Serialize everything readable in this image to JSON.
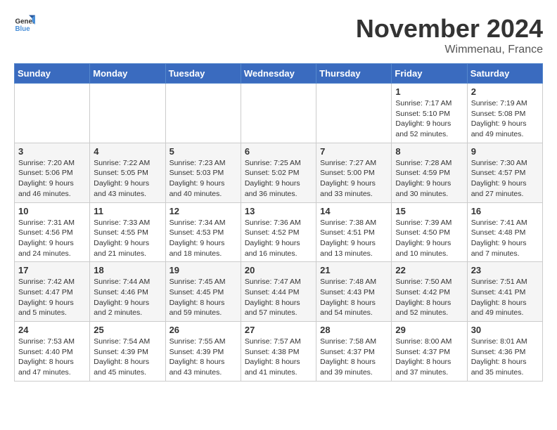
{
  "header": {
    "logo_general": "General",
    "logo_blue": "Blue",
    "month_title": "November 2024",
    "location": "Wimmenau, France"
  },
  "days_of_week": [
    "Sunday",
    "Monday",
    "Tuesday",
    "Wednesday",
    "Thursday",
    "Friday",
    "Saturday"
  ],
  "weeks": [
    [
      {
        "day": "",
        "info": ""
      },
      {
        "day": "",
        "info": ""
      },
      {
        "day": "",
        "info": ""
      },
      {
        "day": "",
        "info": ""
      },
      {
        "day": "",
        "info": ""
      },
      {
        "day": "1",
        "info": "Sunrise: 7:17 AM\nSunset: 5:10 PM\nDaylight: 9 hours and 52 minutes."
      },
      {
        "day": "2",
        "info": "Sunrise: 7:19 AM\nSunset: 5:08 PM\nDaylight: 9 hours and 49 minutes."
      }
    ],
    [
      {
        "day": "3",
        "info": "Sunrise: 7:20 AM\nSunset: 5:06 PM\nDaylight: 9 hours and 46 minutes."
      },
      {
        "day": "4",
        "info": "Sunrise: 7:22 AM\nSunset: 5:05 PM\nDaylight: 9 hours and 43 minutes."
      },
      {
        "day": "5",
        "info": "Sunrise: 7:23 AM\nSunset: 5:03 PM\nDaylight: 9 hours and 40 minutes."
      },
      {
        "day": "6",
        "info": "Sunrise: 7:25 AM\nSunset: 5:02 PM\nDaylight: 9 hours and 36 minutes."
      },
      {
        "day": "7",
        "info": "Sunrise: 7:27 AM\nSunset: 5:00 PM\nDaylight: 9 hours and 33 minutes."
      },
      {
        "day": "8",
        "info": "Sunrise: 7:28 AM\nSunset: 4:59 PM\nDaylight: 9 hours and 30 minutes."
      },
      {
        "day": "9",
        "info": "Sunrise: 7:30 AM\nSunset: 4:57 PM\nDaylight: 9 hours and 27 minutes."
      }
    ],
    [
      {
        "day": "10",
        "info": "Sunrise: 7:31 AM\nSunset: 4:56 PM\nDaylight: 9 hours and 24 minutes."
      },
      {
        "day": "11",
        "info": "Sunrise: 7:33 AM\nSunset: 4:55 PM\nDaylight: 9 hours and 21 minutes."
      },
      {
        "day": "12",
        "info": "Sunrise: 7:34 AM\nSunset: 4:53 PM\nDaylight: 9 hours and 18 minutes."
      },
      {
        "day": "13",
        "info": "Sunrise: 7:36 AM\nSunset: 4:52 PM\nDaylight: 9 hours and 16 minutes."
      },
      {
        "day": "14",
        "info": "Sunrise: 7:38 AM\nSunset: 4:51 PM\nDaylight: 9 hours and 13 minutes."
      },
      {
        "day": "15",
        "info": "Sunrise: 7:39 AM\nSunset: 4:50 PM\nDaylight: 9 hours and 10 minutes."
      },
      {
        "day": "16",
        "info": "Sunrise: 7:41 AM\nSunset: 4:48 PM\nDaylight: 9 hours and 7 minutes."
      }
    ],
    [
      {
        "day": "17",
        "info": "Sunrise: 7:42 AM\nSunset: 4:47 PM\nDaylight: 9 hours and 5 minutes."
      },
      {
        "day": "18",
        "info": "Sunrise: 7:44 AM\nSunset: 4:46 PM\nDaylight: 9 hours and 2 minutes."
      },
      {
        "day": "19",
        "info": "Sunrise: 7:45 AM\nSunset: 4:45 PM\nDaylight: 8 hours and 59 minutes."
      },
      {
        "day": "20",
        "info": "Sunrise: 7:47 AM\nSunset: 4:44 PM\nDaylight: 8 hours and 57 minutes."
      },
      {
        "day": "21",
        "info": "Sunrise: 7:48 AM\nSunset: 4:43 PM\nDaylight: 8 hours and 54 minutes."
      },
      {
        "day": "22",
        "info": "Sunrise: 7:50 AM\nSunset: 4:42 PM\nDaylight: 8 hours and 52 minutes."
      },
      {
        "day": "23",
        "info": "Sunrise: 7:51 AM\nSunset: 4:41 PM\nDaylight: 8 hours and 49 minutes."
      }
    ],
    [
      {
        "day": "24",
        "info": "Sunrise: 7:53 AM\nSunset: 4:40 PM\nDaylight: 8 hours and 47 minutes."
      },
      {
        "day": "25",
        "info": "Sunrise: 7:54 AM\nSunset: 4:39 PM\nDaylight: 8 hours and 45 minutes."
      },
      {
        "day": "26",
        "info": "Sunrise: 7:55 AM\nSunset: 4:39 PM\nDaylight: 8 hours and 43 minutes."
      },
      {
        "day": "27",
        "info": "Sunrise: 7:57 AM\nSunset: 4:38 PM\nDaylight: 8 hours and 41 minutes."
      },
      {
        "day": "28",
        "info": "Sunrise: 7:58 AM\nSunset: 4:37 PM\nDaylight: 8 hours and 39 minutes."
      },
      {
        "day": "29",
        "info": "Sunrise: 8:00 AM\nSunset: 4:37 PM\nDaylight: 8 hours and 37 minutes."
      },
      {
        "day": "30",
        "info": "Sunrise: 8:01 AM\nSunset: 4:36 PM\nDaylight: 8 hours and 35 minutes."
      }
    ]
  ]
}
